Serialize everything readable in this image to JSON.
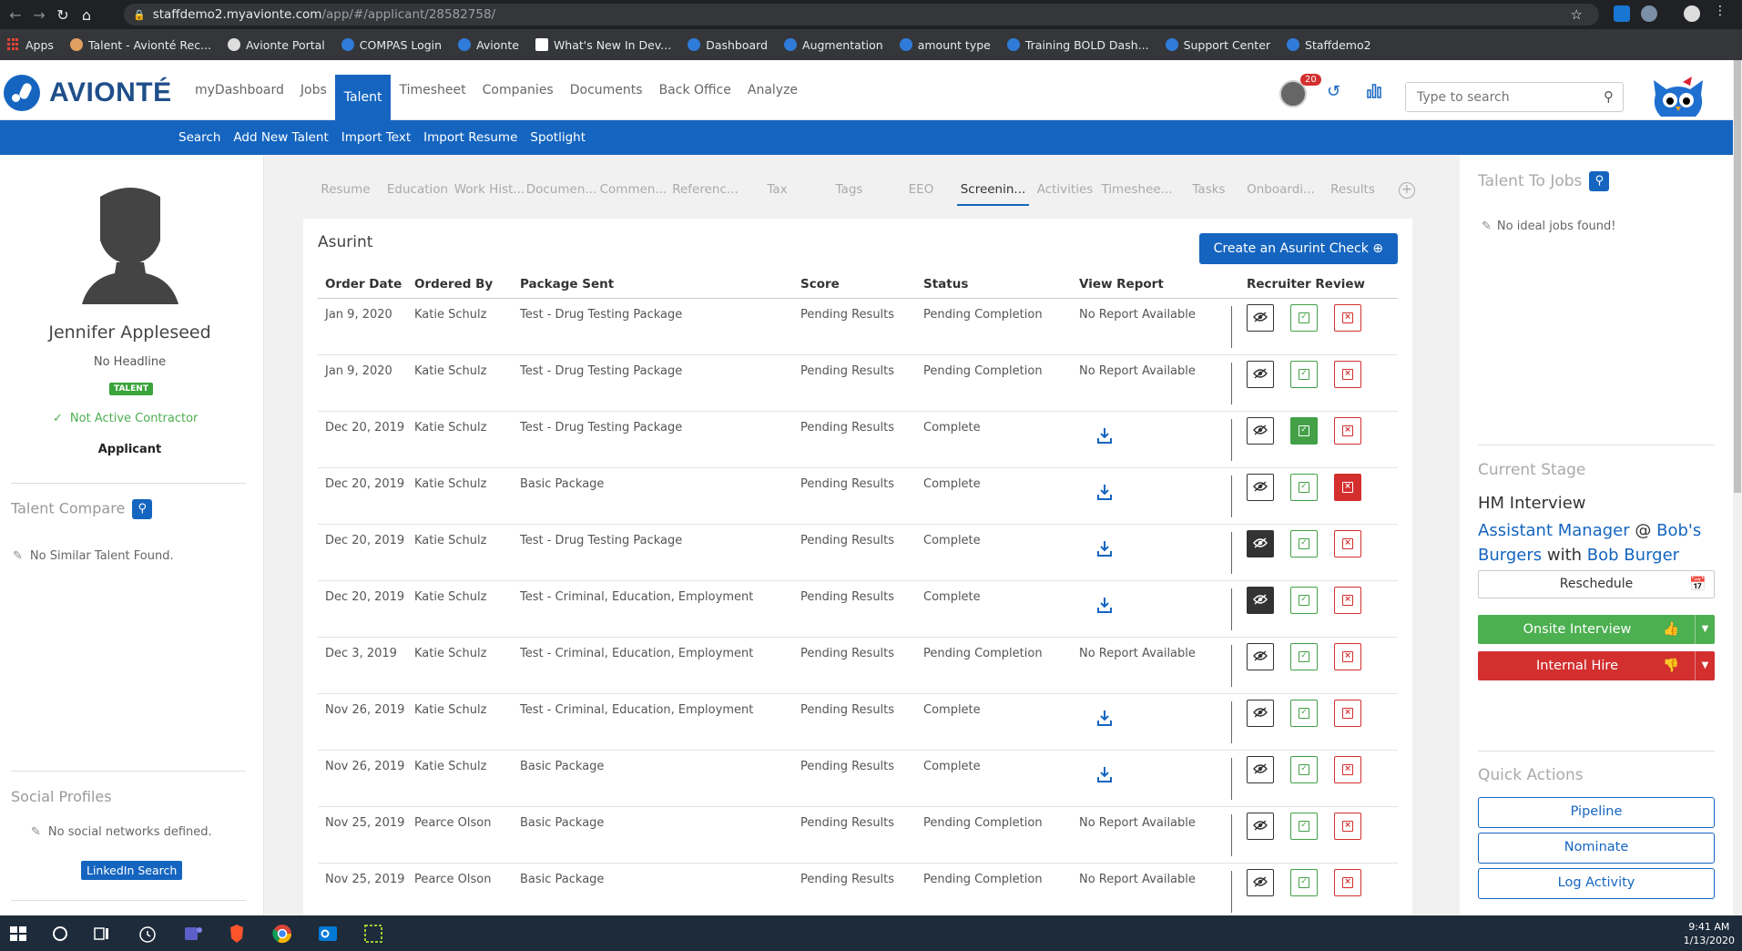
{
  "browser": {
    "url_host": "staffdemo2.myavionte.com",
    "url_path": "/app/#/applicant/28582758/",
    "bookmarks": [
      "Apps",
      "Talent - Avionté Rec...",
      "Avionte Portal",
      "COMPAS Login",
      "Avionte",
      "What's New In Dev...",
      "Dashboard",
      "Augmentation",
      "amount type",
      "Training BOLD Dash...",
      "Support Center",
      "Staffdemo2"
    ]
  },
  "header": {
    "logo": "AVIONTÉ",
    "nav": [
      "myDashboard",
      "Jobs",
      "Talent",
      "Timesheet",
      "Companies",
      "Documents",
      "Back Office",
      "Analyze"
    ],
    "active_nav": "Talent",
    "notification_count": "20",
    "search_placeholder": "Type to search"
  },
  "subnav": [
    "Search",
    "Add New Talent",
    "Import Text",
    "Import Resume",
    "Spotlight"
  ],
  "profile": {
    "name": "Jennifer Appleseed",
    "headline": "No Headline",
    "badge": "TALENT",
    "contractor_status": "Not Active Contractor",
    "status": "Applicant",
    "compare_title": "Talent Compare",
    "compare_note": "No Similar Talent Found.",
    "social_title": "Social Profiles",
    "social_note": "No social networks defined.",
    "linkedin_button": "LinkedIn Search"
  },
  "tabs": [
    "Resume",
    "Education",
    "Work Hist...",
    "Documen...",
    "Commen...",
    "Referenc...",
    "Tax",
    "Tags",
    "EEO",
    "Screenin...",
    "Activities",
    "Timeshee...",
    "Tasks",
    "Onboardi...",
    "Results"
  ],
  "active_tab": "Screenin...",
  "screening": {
    "title": "Asurint",
    "create_button": "Create an Asurint Check",
    "columns": [
      "Order Date",
      "Ordered By",
      "Package Sent",
      "Score",
      "Status",
      "View Report",
      "Recruiter Review"
    ],
    "rows": [
      {
        "date": "Jan 9, 2020",
        "by": "Katie Schulz",
        "package": "Test - Drug Testing Package",
        "score": "Pending Results",
        "status": "Pending Completion",
        "report": "No Report Available",
        "review": "none"
      },
      {
        "date": "Jan 9, 2020",
        "by": "Katie Schulz",
        "package": "Test - Drug Testing Package",
        "score": "Pending Results",
        "status": "Pending Completion",
        "report": "No Report Available",
        "review": "none"
      },
      {
        "date": "Dec 20, 2019",
        "by": "Katie Schulz",
        "package": "Test - Drug Testing Package",
        "score": "Pending Results",
        "status": "Complete",
        "report": "",
        "review": "approve"
      },
      {
        "date": "Dec 20, 2019",
        "by": "Katie Schulz",
        "package": "Basic Package",
        "score": "Pending Results",
        "status": "Complete",
        "report": "",
        "review": "reject"
      },
      {
        "date": "Dec 20, 2019",
        "by": "Katie Schulz",
        "package": "Test - Drug Testing Package",
        "score": "Pending Results",
        "status": "Complete",
        "report": "",
        "review": "hide"
      },
      {
        "date": "Dec 20, 2019",
        "by": "Katie Schulz",
        "package": "Test - Criminal, Education, Employment",
        "score": "Pending Results",
        "status": "Complete",
        "report": "",
        "review": "hide"
      },
      {
        "date": "Dec 3, 2019",
        "by": "Katie Schulz",
        "package": "Test - Criminal, Education, Employment",
        "score": "Pending Results",
        "status": "Pending Completion",
        "report": "No Report Available",
        "review": "none"
      },
      {
        "date": "Nov 26, 2019",
        "by": "Katie Schulz",
        "package": "Test - Criminal, Education, Employment",
        "score": "Pending Results",
        "status": "Complete",
        "report": "",
        "review": "none"
      },
      {
        "date": "Nov 26, 2019",
        "by": "Katie Schulz",
        "package": "Basic Package",
        "score": "Pending Results",
        "status": "Complete",
        "report": "",
        "review": "none"
      },
      {
        "date": "Nov 25, 2019",
        "by": "Pearce Olson",
        "package": "Basic Package",
        "score": "Pending Results",
        "status": "Pending Completion",
        "report": "No Report Available",
        "review": "none"
      },
      {
        "date": "Nov 25, 2019",
        "by": "Pearce Olson",
        "package": "Basic Package",
        "score": "Pending Results",
        "status": "Pending Completion",
        "report": "No Report Available",
        "review": "none"
      }
    ]
  },
  "right": {
    "jobs_title": "Talent To Jobs",
    "jobs_note": "No ideal jobs found!",
    "stage_title": "Current Stage",
    "stage_name": "HM Interview",
    "job_link": "Assistant Manager",
    "at": "@",
    "company_link": "Bob's Burgers",
    "with": "with",
    "contact_link": "Bob Burger",
    "reschedule": "Reschedule",
    "onsite": "Onsite Interview",
    "internal": "Internal Hire",
    "quick_title": "Quick Actions",
    "quick_actions": [
      "Pipeline",
      "Nominate",
      "Log Activity"
    ]
  },
  "taskbar": {
    "time": "9:41 AM",
    "date": "1/13/2020"
  },
  "colors": {
    "primary": "#1565c0",
    "success": "#43a047",
    "danger": "#d32f2f"
  }
}
